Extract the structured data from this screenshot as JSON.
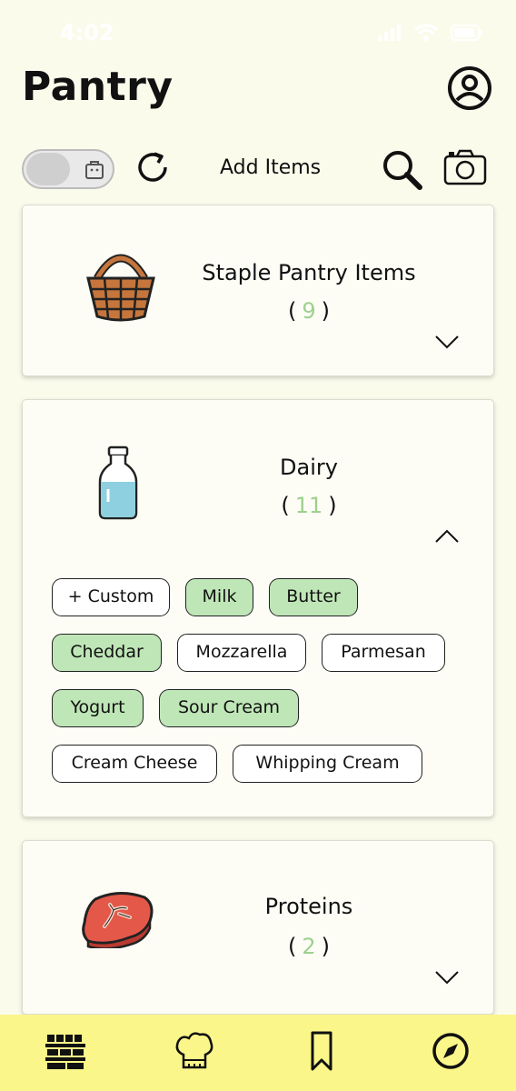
{
  "status": {
    "time": "4:02"
  },
  "header": {
    "title": "Pantry"
  },
  "toolbar": {
    "add_items_label": "Add Items"
  },
  "categories": [
    {
      "name": "Staple Pantry Items",
      "count_open": "(",
      "count": "9",
      "count_close": ")",
      "expanded": false,
      "icon": "basket-icon"
    },
    {
      "name": "Dairy",
      "count_open": "(",
      "count": "11",
      "count_close": ")",
      "expanded": true,
      "icon": "milk-bottle-icon",
      "chips": [
        {
          "label": "+ Custom",
          "selected": false
        },
        {
          "label": "Milk",
          "selected": true
        },
        {
          "label": "Butter",
          "selected": true
        },
        {
          "label": "Cheddar",
          "selected": true
        },
        {
          "label": "Mozzarella",
          "selected": false
        },
        {
          "label": "Parmesan",
          "selected": false
        },
        {
          "label": "Yogurt",
          "selected": true
        },
        {
          "label": "Sour Cream",
          "selected": true
        },
        {
          "label": "Cream Cheese",
          "selected": false
        },
        {
          "label": "Whipping Cream",
          "selected": false
        }
      ]
    },
    {
      "name": "Proteins",
      "count_open": "(",
      "count": "2",
      "count_close": ")",
      "expanded": false,
      "icon": "steak-icon"
    }
  ],
  "tabs": [
    {
      "name": "pantry",
      "icon": "pantry-shelf-icon",
      "active": true
    },
    {
      "name": "recipes",
      "icon": "chef-hat-icon",
      "active": false
    },
    {
      "name": "saved",
      "icon": "bookmark-icon",
      "active": false
    },
    {
      "name": "explore",
      "icon": "compass-icon",
      "active": false
    }
  ],
  "colors": {
    "background": "#fbfbec",
    "chip_selected": "#bfe6b7",
    "count_accent": "#9ed08e",
    "tab_bar": "#fbf68a"
  }
}
